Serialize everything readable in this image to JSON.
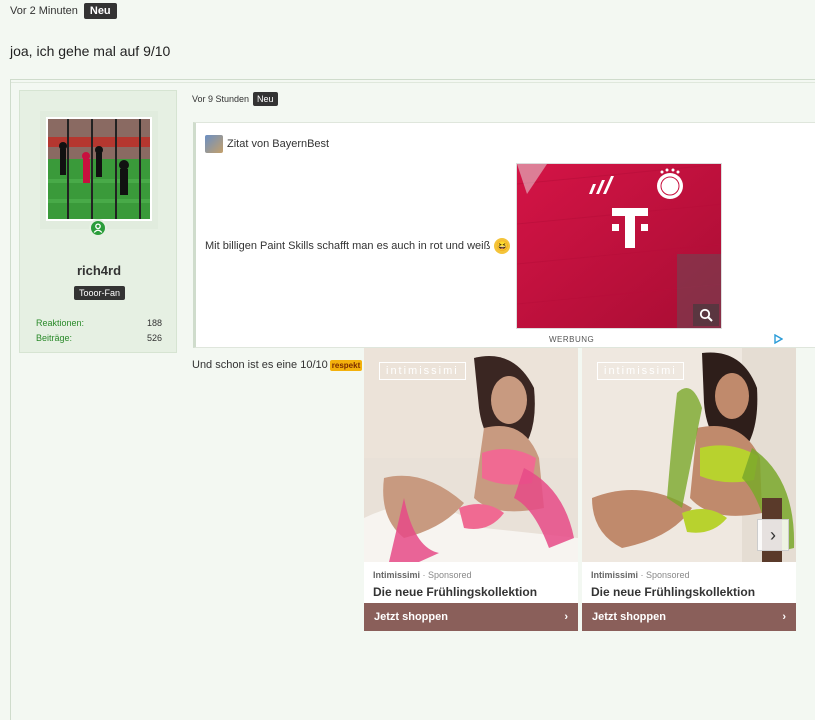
{
  "post1": {
    "time": "Vor 2 Minuten",
    "badge": "Neu",
    "text": "joa, ich gehe mal auf 9/10"
  },
  "post2": {
    "time": "Vor 9 Stunden",
    "badge": "Neu",
    "user": {
      "name": "rich4rd",
      "title": "Tooor-Fan",
      "stats": [
        {
          "label": "Reaktionen:",
          "value": "188"
        },
        {
          "label": "Beiträge:",
          "value": "526"
        }
      ]
    },
    "quote": {
      "header": "Zitat von BayernBest",
      "text": "Mit billigen Paint Skills schafft man es auch in rot und weiß"
    },
    "reply": "Und schon ist es eine 10/10",
    "respekt": "respekt"
  },
  "ad": {
    "label": "WERBUNG",
    "cards": [
      {
        "brand": "intimissimi",
        "sponsor_brand": "Intimissimi",
        "sponsor_suffix": " · Sponsored",
        "title": "Die neue Frühlingskollektion",
        "cta": "Jetzt shoppen"
      },
      {
        "brand": "intimissimi",
        "sponsor_brand": "Intimissimi",
        "sponsor_suffix": " · Sponsored",
        "title": "Die neue Frühlingskollektion",
        "cta": "Jetzt shoppen"
      }
    ]
  },
  "colors": {
    "page_bg": "#f3f8f2",
    "accent_green": "#2a9d3a",
    "badge_dark": "#333333",
    "ad_cta": "#8a5f5a",
    "jersey_red": "#c8103e"
  },
  "icons": [
    "user-online-icon",
    "zoom-icon",
    "laugh-emoji-icon",
    "adchoices-icon",
    "chevron-right-icon"
  ]
}
